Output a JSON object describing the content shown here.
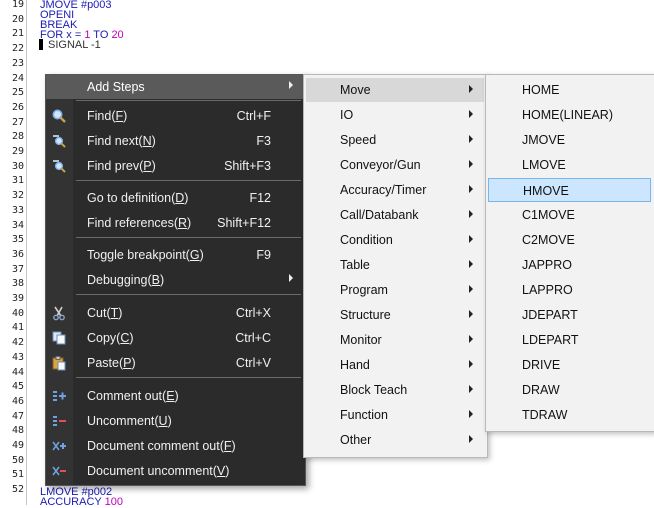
{
  "editor": {
    "line_numbers": [
      "19",
      "20",
      "21",
      "22",
      "23",
      "24",
      "25",
      "26",
      "27",
      "28",
      "29",
      "30",
      "31",
      "32",
      "33",
      "34",
      "35",
      "36",
      "37",
      "38",
      "39",
      "40",
      "41",
      "42",
      "43",
      "44",
      "45",
      "46",
      "47",
      "48",
      "49",
      "50",
      "51",
      "52"
    ],
    "lines": {
      "l19": "JMOVE #p003",
      "l20": "OPENI",
      "l21": "BREAK",
      "l22_prefix": "FOR x = ",
      "l22_num1": "1",
      "l22_mid": " TO ",
      "l22_num2": "20",
      "l23": "SIGNAL -1",
      "l51": "LMOVE #p002",
      "l52_prefix": "ACCURACY ",
      "l52_num": "100"
    }
  },
  "context_menu": {
    "items": [
      {
        "id": "add_steps",
        "label": "Add Steps",
        "shortcut": "",
        "icon": "",
        "submenu": true
      },
      {
        "id": "find",
        "label": "Find(F)",
        "label_main": "Find(",
        "mnemonic": "F",
        "label_end": ")",
        "shortcut": "Ctrl+F",
        "icon": "search-icon"
      },
      {
        "id": "find_next",
        "label_main": "Find next(",
        "mnemonic": "N",
        "label_end": ")",
        "shortcut": "F3",
        "icon": "find-next-icon"
      },
      {
        "id": "find_prev",
        "label_main": "Find prev(",
        "mnemonic": "P",
        "label_end": ")",
        "shortcut": "Shift+F3",
        "icon": "find-prev-icon"
      },
      {
        "id": "go_def",
        "label_main": "Go to definition(",
        "mnemonic": "D",
        "label_end": ")",
        "shortcut": "F12",
        "icon": ""
      },
      {
        "id": "find_refs",
        "label_main": "Find references(",
        "mnemonic": "R",
        "label_end": ")",
        "shortcut": "Shift+F12",
        "icon": ""
      },
      {
        "id": "toggle_bp",
        "label_main": "Toggle breakpoint(",
        "mnemonic": "G",
        "label_end": ")",
        "shortcut": "F9",
        "icon": ""
      },
      {
        "id": "debugging",
        "label_main": "Debugging(",
        "mnemonic": "B",
        "label_end": ")",
        "shortcut": "",
        "icon": "",
        "submenu": true
      },
      {
        "id": "cut",
        "label_main": "Cut(",
        "mnemonic": "T",
        "label_end": ")",
        "shortcut": "Ctrl+X",
        "icon": "scissors-icon"
      },
      {
        "id": "copy",
        "label_main": "Copy(",
        "mnemonic": "C",
        "label_end": ")",
        "shortcut": "Ctrl+C",
        "icon": "copy-icon"
      },
      {
        "id": "paste",
        "label_main": "Paste(",
        "mnemonic": "P",
        "label_end": ")",
        "shortcut": "Ctrl+V",
        "icon": "paste-icon"
      },
      {
        "id": "comment",
        "label_main": "Comment out(",
        "mnemonic": "E",
        "label_end": ")",
        "shortcut": "",
        "icon": "comment-out-icon"
      },
      {
        "id": "uncomment",
        "label_main": "Uncomment(",
        "mnemonic": "U",
        "label_end": ")",
        "shortcut": "",
        "icon": "uncomment-icon"
      },
      {
        "id": "doc_comment",
        "label_main": "Document comment out(",
        "mnemonic": "F",
        "label_end": ")",
        "shortcut": "",
        "icon": "doc-comment-icon"
      },
      {
        "id": "doc_uncomment",
        "label_main": "Document uncomment(",
        "mnemonic": "V",
        "label_end": ")",
        "shortcut": "",
        "icon": "doc-uncomment-icon"
      }
    ]
  },
  "add_steps_submenu": {
    "items": [
      "Move",
      "IO",
      "Speed",
      "Conveyor/Gun",
      "Accuracy/Timer",
      "Call/Databank",
      "Condition",
      "Table",
      "Program",
      "Structure",
      "Monitor",
      "Hand",
      "Block Teach",
      "Function",
      "Other"
    ],
    "highlighted": "Move"
  },
  "move_submenu": {
    "items": [
      "HOME",
      "HOME(LINEAR)",
      "JMOVE",
      "LMOVE",
      "HMOVE",
      "C1MOVE",
      "C2MOVE",
      "JAPPRO",
      "LAPPRO",
      "JDEPART",
      "LDEPART",
      "DRIVE",
      "DRAW",
      "TDRAW"
    ],
    "selected": "HMOVE"
  },
  "colors": {
    "menu_bg": "#2b2b2b",
    "menu_highlight": "#5a5a5a",
    "selection": "#cce6ff",
    "code_blue": "#1b1bb5",
    "code_number": "#c000c0"
  }
}
